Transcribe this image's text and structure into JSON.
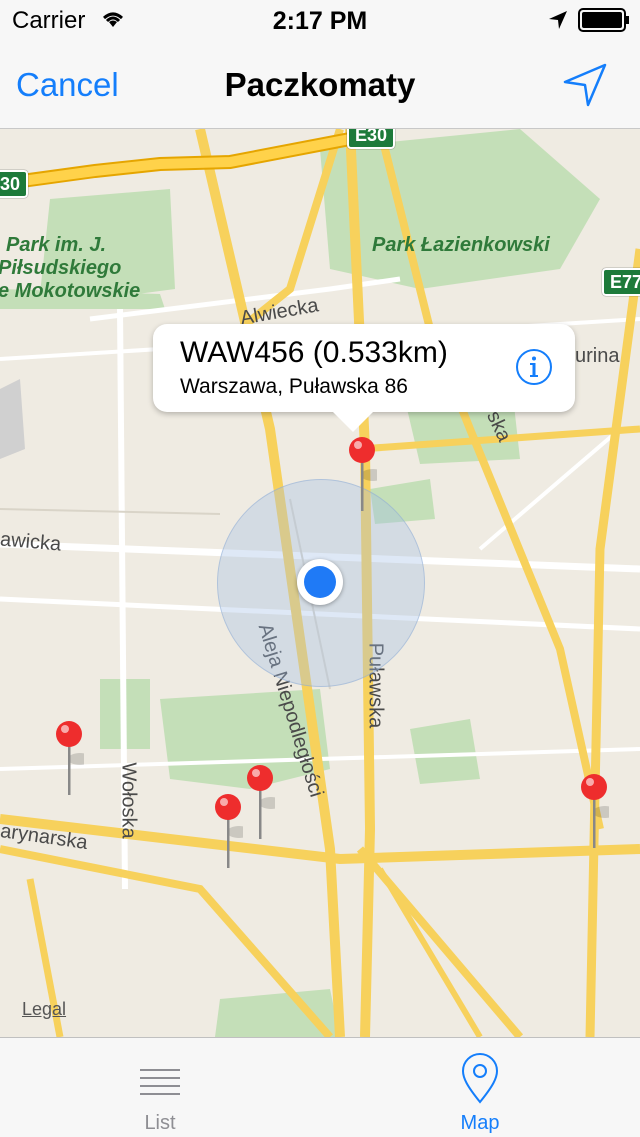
{
  "status_bar": {
    "carrier": "Carrier",
    "time": "2:17 PM"
  },
  "nav_bar": {
    "cancel_label": "Cancel",
    "title": "Paczkomaty"
  },
  "map": {
    "streets": [
      "Alwiecka",
      "awicka",
      "Aleja Niepodległości",
      "Puławska",
      "Wołoska",
      "arynarska",
      "urina",
      "erska"
    ],
    "parks": [
      "Park im. J.",
      "Piłsudskiego",
      "e Mokotowskie",
      "Park Łazienkowski"
    ],
    "road_shields": [
      "E30",
      "30",
      "E77"
    ],
    "legal": "Legal",
    "callout": {
      "title": "WAW456 (0.533km)",
      "subtitle": "Warszawa, Puławska 86"
    }
  },
  "tab_bar": {
    "tabs": [
      {
        "label": "List",
        "selected": false
      },
      {
        "label": "Map",
        "selected": true
      }
    ]
  },
  "colors": {
    "accent": "#147efb",
    "pin": "#ee2d2d",
    "user_location": "#1f7af6",
    "road_major": "#ffd24a",
    "park": "#c4dfb8"
  }
}
